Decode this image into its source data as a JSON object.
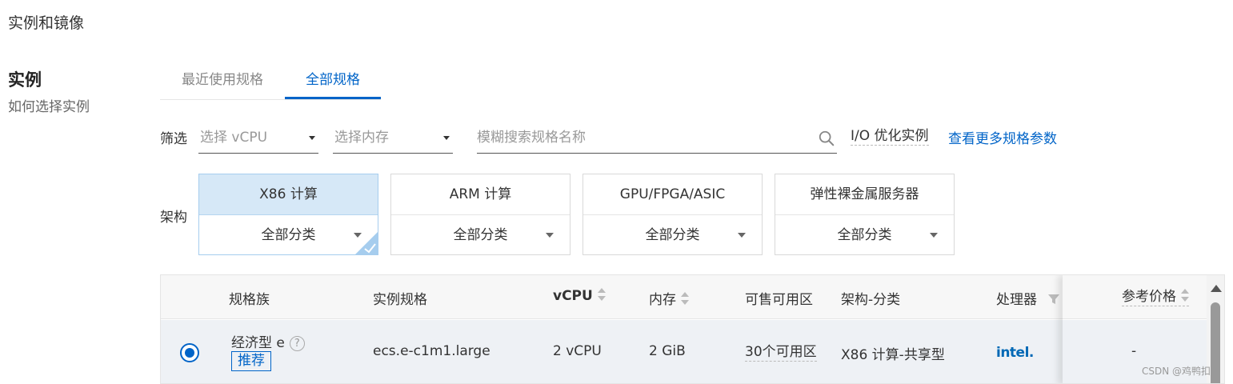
{
  "section": {
    "title": "实例和镜像"
  },
  "instance": {
    "title": "实例",
    "help": "如何选择实例"
  },
  "tabs": [
    {
      "label": "最近使用规格",
      "active": false
    },
    {
      "label": "全部规格",
      "active": true
    }
  ],
  "filter": {
    "label": "筛选",
    "vcpu_placeholder": "选择 vCPU",
    "mem_placeholder": "选择内存",
    "search_placeholder": "模糊搜索规格名称",
    "io_optimized": "I/O 优化实例",
    "more_params": "查看更多规格参数"
  },
  "architecture": {
    "label": "架构",
    "cards": [
      {
        "name": "X86 计算",
        "category": "全部分类",
        "selected": true
      },
      {
        "name": "ARM 计算",
        "category": "全部分类",
        "selected": false
      },
      {
        "name": "GPU/FPGA/ASIC",
        "category": "全部分类",
        "selected": false
      },
      {
        "name": "弹性裸金属服务器",
        "category": "全部分类",
        "selected": false
      }
    ]
  },
  "table": {
    "headers": {
      "family": "规格族",
      "spec": "实例规格",
      "vcpu": "vCPU",
      "memory": "内存",
      "zones": "可售可用区",
      "arch": "架构-分类",
      "processor": "处理器",
      "price": "参考价格"
    },
    "rows": [
      {
        "selected": true,
        "family": "经济型 e",
        "badge": "推荐",
        "spec": "ecs.e-c1m1.large",
        "vcpu": "2 vCPU",
        "memory": "2 GiB",
        "zones": "30个可用区",
        "arch": "X86 计算-共享型",
        "processor": "intel.",
        "price": "-"
      }
    ]
  },
  "watermark": "CSDN @鸡鸭扣",
  "colors": {
    "accent": "#0064c8",
    "selected_bg": "#d6e8f7",
    "row_bg": "#eef1f5"
  }
}
